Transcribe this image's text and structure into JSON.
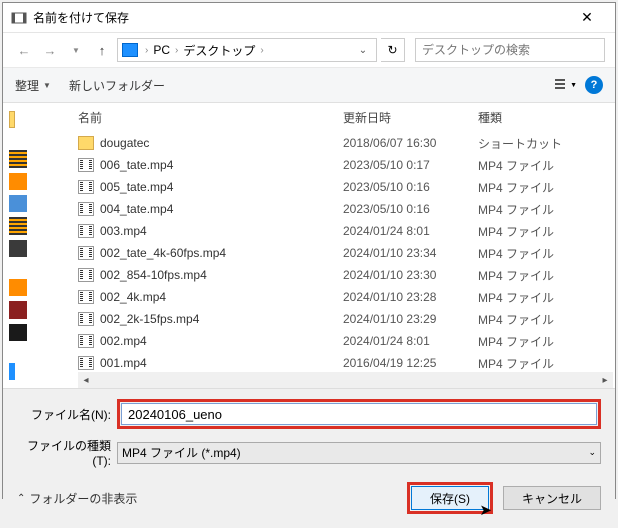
{
  "title": "名前を付けて保存",
  "path": {
    "pc": "PC",
    "folder": "デスクトップ"
  },
  "search_placeholder": "デスクトップの検索",
  "toolbar": {
    "organize": "整理",
    "newfolder": "新しいフォルダー"
  },
  "columns": {
    "name": "名前",
    "date": "更新日時",
    "type": "種類"
  },
  "files": [
    {
      "name": "dougatec",
      "date": "2018/06/07 16:30",
      "type": "ショートカット",
      "kind": "folder"
    },
    {
      "name": "006_tate.mp4",
      "date": "2023/05/10 0:17",
      "type": "MP4 ファイル",
      "kind": "mp4"
    },
    {
      "name": "005_tate.mp4",
      "date": "2023/05/10 0:16",
      "type": "MP4 ファイル",
      "kind": "mp4"
    },
    {
      "name": "004_tate.mp4",
      "date": "2023/05/10 0:16",
      "type": "MP4 ファイル",
      "kind": "mp4"
    },
    {
      "name": "003.mp4",
      "date": "2024/01/24 8:01",
      "type": "MP4 ファイル",
      "kind": "mp4"
    },
    {
      "name": "002_tate_4k-60fps.mp4",
      "date": "2024/01/10 23:34",
      "type": "MP4 ファイル",
      "kind": "mp4"
    },
    {
      "name": "002_854-10fps.mp4",
      "date": "2024/01/10 23:30",
      "type": "MP4 ファイル",
      "kind": "mp4"
    },
    {
      "name": "002_4k.mp4",
      "date": "2024/01/10 23:28",
      "type": "MP4 ファイル",
      "kind": "mp4"
    },
    {
      "name": "002_2k-15fps.mp4",
      "date": "2024/01/10 23:29",
      "type": "MP4 ファイル",
      "kind": "mp4"
    },
    {
      "name": "002.mp4",
      "date": "2024/01/24 8:01",
      "type": "MP4 ファイル",
      "kind": "mp4"
    },
    {
      "name": "001.mp4",
      "date": "2016/04/19 12:25",
      "type": "MP4 ファイル",
      "kind": "mp4"
    }
  ],
  "labels": {
    "filename": "ファイル名(N):",
    "filetype": "ファイルの種類(T):",
    "foldhide": "フォルダーの非表示",
    "save": "保存(S)",
    "cancel": "キャンセル"
  },
  "filename_value": "20240106_ueno",
  "filetype_value": "MP4 ファイル (*.mp4)"
}
